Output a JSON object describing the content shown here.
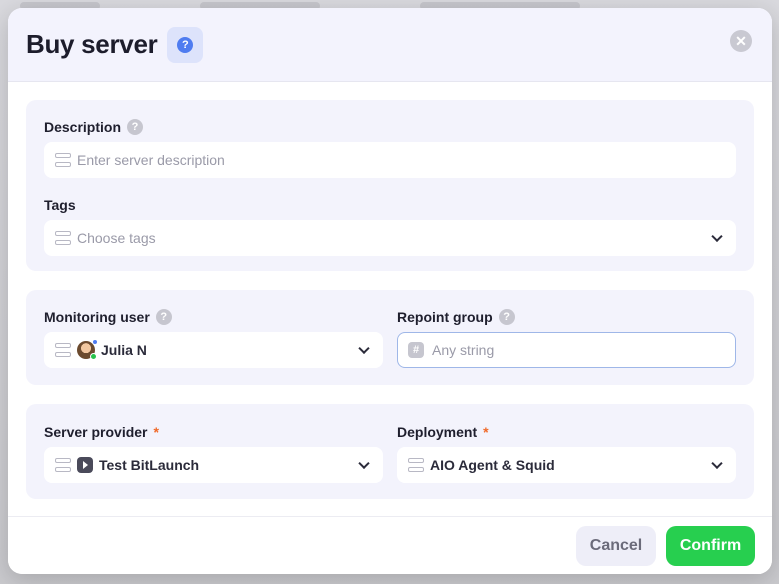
{
  "modal": {
    "title": "Buy server",
    "help_glyph": "?",
    "close_glyph": "✕"
  },
  "description": {
    "label": "Description",
    "help_glyph": "?",
    "placeholder": "Enter server description"
  },
  "tags": {
    "label": "Tags",
    "placeholder": "Choose tags"
  },
  "monitoring_user": {
    "label": "Monitoring user",
    "help_glyph": "?",
    "value": "Julia N"
  },
  "repoint_group": {
    "label": "Repoint group",
    "help_glyph": "?",
    "placeholder": "Any string",
    "icon_glyph": "#"
  },
  "server_provider": {
    "label": "Server provider",
    "required_mark": "*",
    "value": "Test BitLaunch"
  },
  "deployment": {
    "label": "Deployment",
    "required_mark": "*",
    "value": "AIO Agent & Squid"
  },
  "footer": {
    "cancel_label": "Cancel",
    "confirm_label": "Confirm"
  },
  "colors": {
    "accent_blue": "#4f7cf0",
    "confirm_green": "#27cf4f",
    "required_orange": "#f06a2a",
    "section_bg": "#f3f3fc"
  },
  "icons": {
    "field_lead": "server-stack-icon",
    "help": "help-circle-icon",
    "close": "close-icon",
    "chevron": "chevron-down-icon",
    "provider": "bitlaunch-icon",
    "hash": "hash-icon"
  }
}
